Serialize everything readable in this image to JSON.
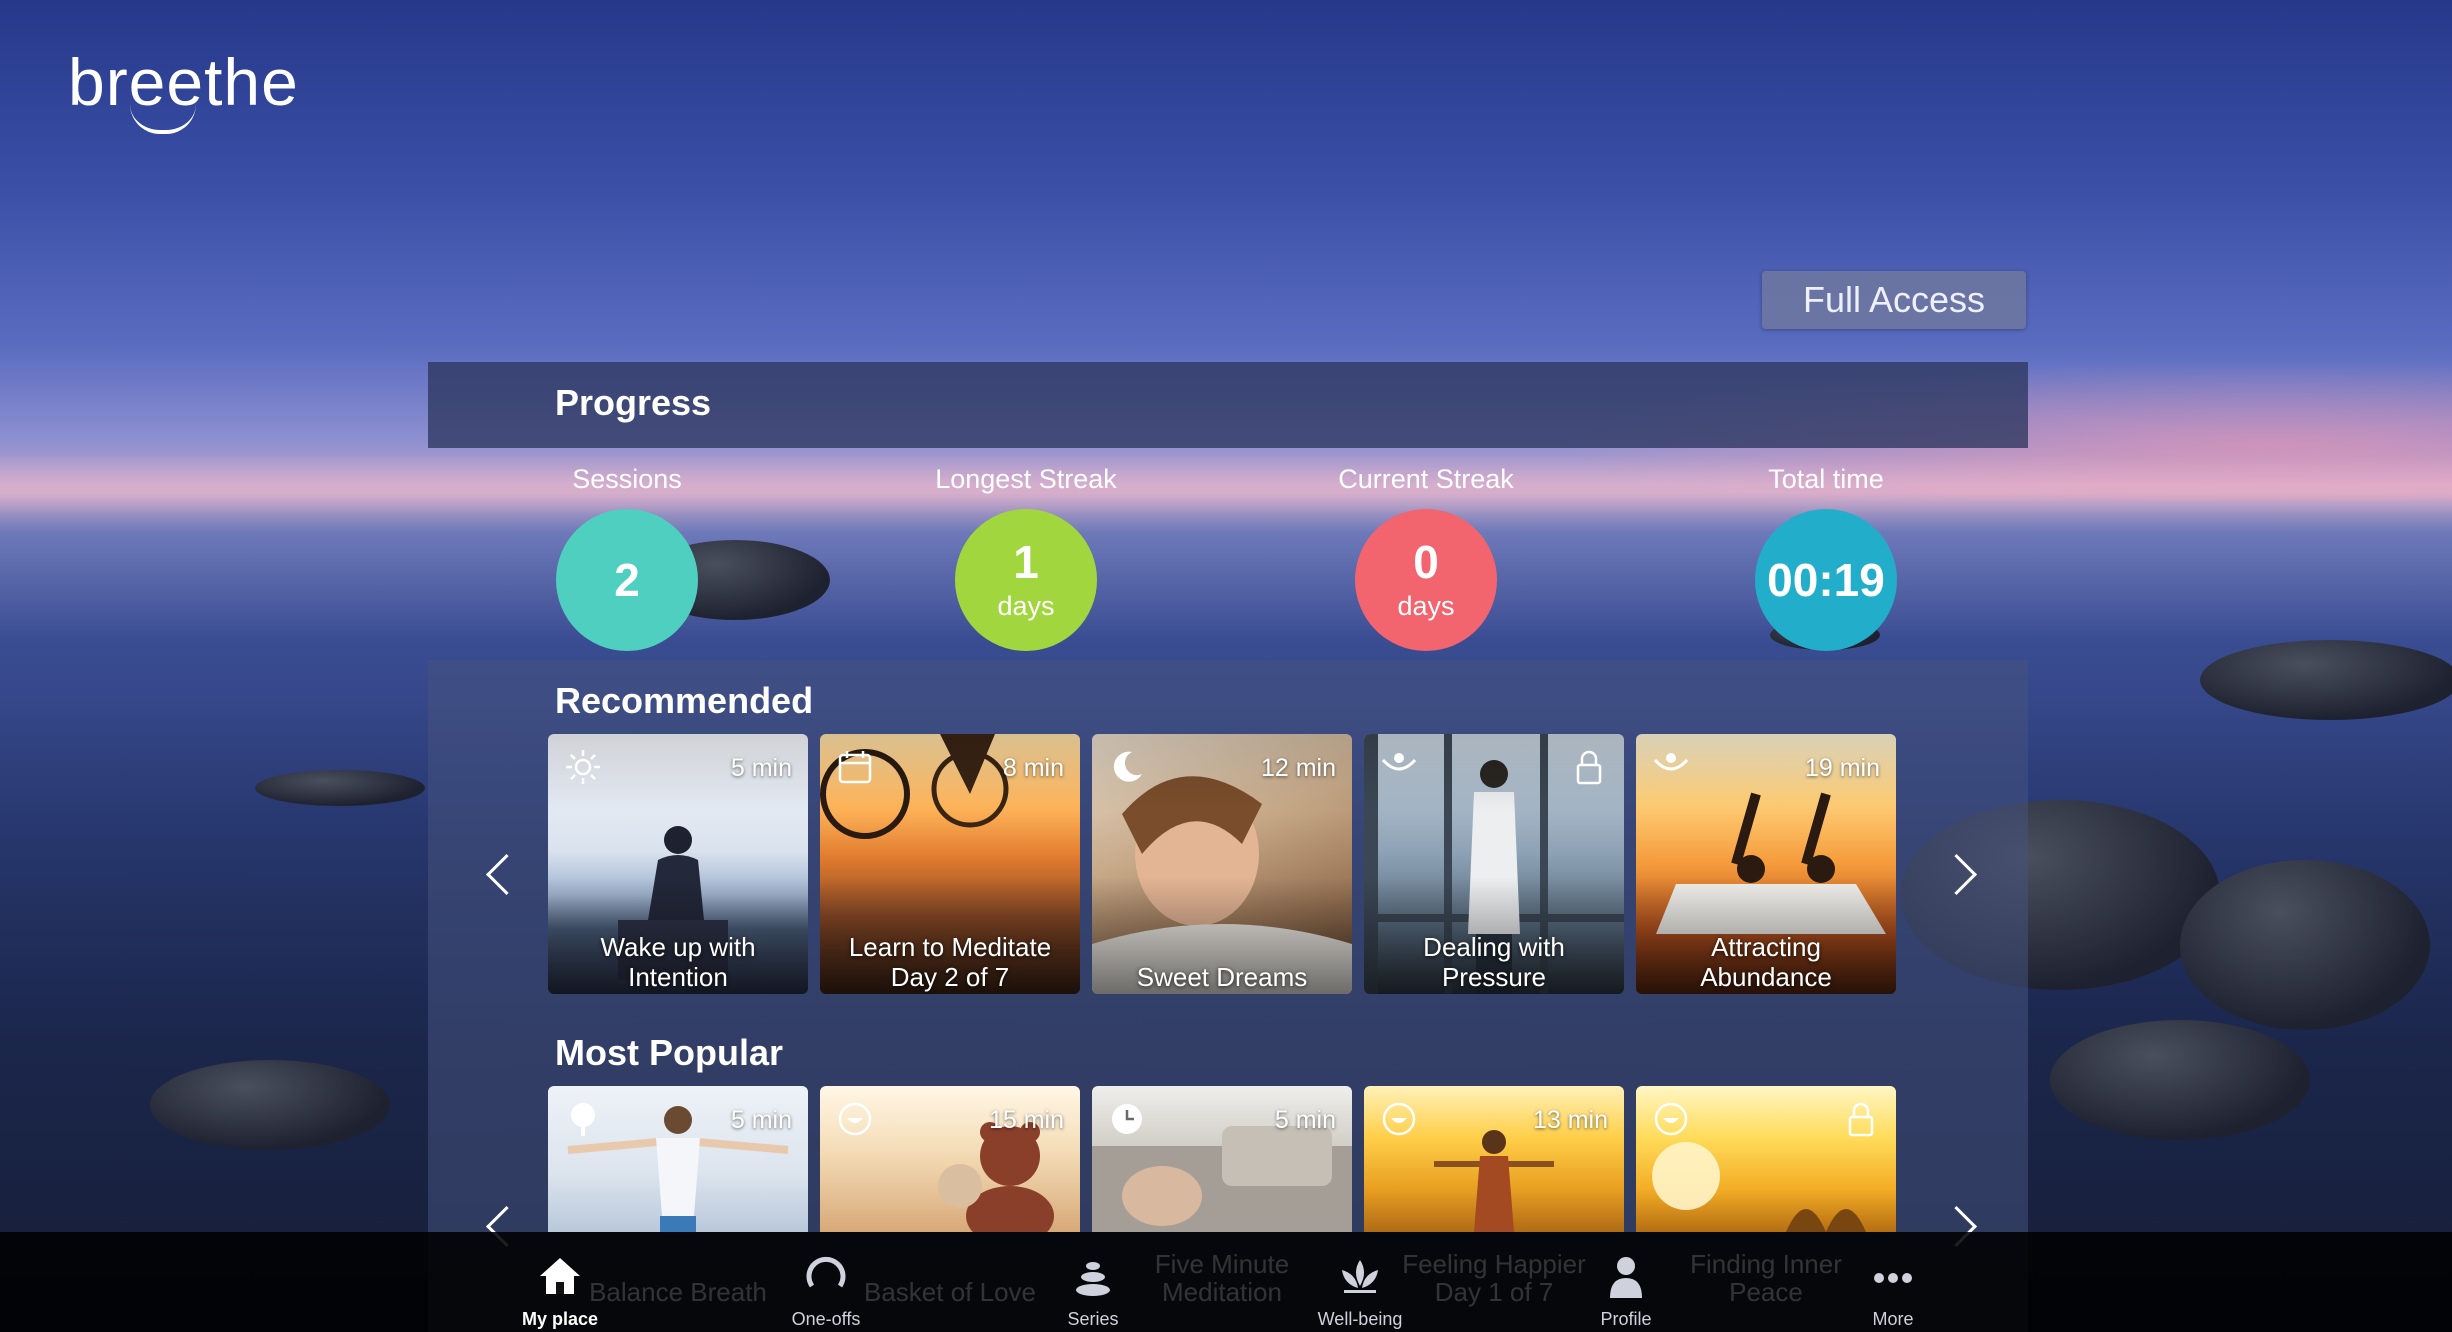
{
  "app": {
    "logo_text": "breethe"
  },
  "header": {
    "full_access_label": "Full Access"
  },
  "progress": {
    "title": "Progress",
    "stats": [
      {
        "label": "Sessions",
        "value": "2",
        "unit": "",
        "color": "#4fcfc0"
      },
      {
        "label": "Longest Streak",
        "value": "1",
        "unit": "days",
        "color": "#a2d63f"
      },
      {
        "label": "Current Streak",
        "value": "0",
        "unit": "days",
        "color": "#f2646e"
      },
      {
        "label": "Total time",
        "value": "00:19",
        "unit": "",
        "color": "#22aecb"
      }
    ]
  },
  "recommended": {
    "title": "Recommended",
    "cards": [
      {
        "title_line1": "Wake up with",
        "title_line2": "Intention",
        "duration": "5 min",
        "icon": "sun-icon",
        "locked": false
      },
      {
        "title_line1": "Learn to Meditate",
        "title_line2": "Day 2 of 7",
        "duration": "8 min",
        "icon": "calendar-icon",
        "locked": false
      },
      {
        "title_line1": "",
        "title_line2": "Sweet Dreams",
        "duration": "12 min",
        "icon": "moon-icon",
        "locked": false
      },
      {
        "title_line1": "Dealing with",
        "title_line2": "Pressure",
        "duration": "",
        "icon": "raised-arms-icon",
        "locked": true
      },
      {
        "title_line1": "Attracting",
        "title_line2": "Abundance",
        "duration": "19 min",
        "icon": "raised-arms-icon",
        "locked": false
      }
    ]
  },
  "most_popular": {
    "title": "Most Popular",
    "cards": [
      {
        "duration": "5 min",
        "icon": "tree-icon",
        "locked": false,
        "title_line1": "Balance Breath",
        "title_line2": ""
      },
      {
        "duration": "15 min",
        "icon": "smile-icon",
        "locked": false,
        "title_line1": "Basket of Love",
        "title_line2": ""
      },
      {
        "duration": "5 min",
        "icon": "clock-icon",
        "locked": false,
        "title_line1": "Five Minute",
        "title_line2": "Meditation"
      },
      {
        "duration": "13 min",
        "icon": "smile-icon",
        "locked": false,
        "title_line1": "Feeling Happier",
        "title_line2": "Day 1 of 7"
      },
      {
        "duration": "",
        "icon": "smile-icon",
        "locked": true,
        "title_line1": "Finding Inner",
        "title_line2": "Peace"
      }
    ]
  },
  "nav": {
    "items": [
      {
        "label": "My place",
        "icon": "home-icon",
        "active": true
      },
      {
        "label": "One-offs",
        "icon": "circle-icon",
        "active": false
      },
      {
        "label": "Series",
        "icon": "stones-icon",
        "active": false
      },
      {
        "label": "Well-being",
        "icon": "lotus-icon",
        "active": false
      },
      {
        "label": "Profile",
        "icon": "person-icon",
        "active": false
      },
      {
        "label": "More",
        "icon": "dots-icon",
        "active": false
      }
    ]
  }
}
